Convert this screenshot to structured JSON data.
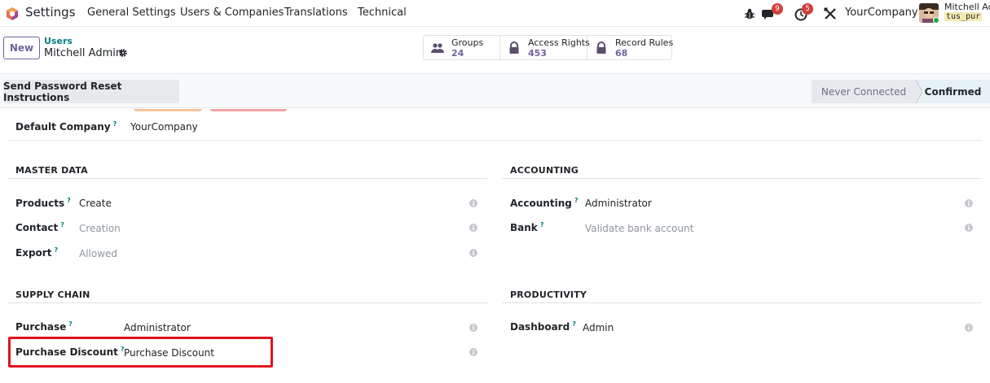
{
  "navbar": {
    "app_name": "Settings",
    "menu": [
      "General Settings",
      "Users & Companies",
      "Translations",
      "Technical"
    ],
    "messages_badge": "9",
    "activity_badge": "5",
    "company": "YourCompany",
    "user_name": "Mitchell Admin",
    "db_name": "tus_pur"
  },
  "control_panel": {
    "new_label": "New",
    "breadcrumb_parent": "Users",
    "breadcrumb_current": "Mitchell Admin",
    "smart_buttons": [
      {
        "label": "Groups",
        "value": "24",
        "icon": "users-icon"
      },
      {
        "label": "Access Rights",
        "value": "453",
        "icon": "lock-icon"
      },
      {
        "label": "Record Rules",
        "value": "68",
        "icon": "lock-icon"
      }
    ]
  },
  "statusbar": {
    "reset_label": "Send Password Reset Instructions",
    "stages": [
      "Never Connected",
      "Confirmed"
    ],
    "active_stage": "Confirmed"
  },
  "form": {
    "default_company_label": "Default Company",
    "default_company_value": "YourCompany",
    "help_mark": "?",
    "sections": {
      "master_data": {
        "title": "MASTER DATA",
        "fields": [
          {
            "label": "Products",
            "value": "Create"
          },
          {
            "label": "Contact",
            "value": "Creation"
          },
          {
            "label": "Export",
            "value": "Allowed"
          }
        ]
      },
      "accounting": {
        "title": "ACCOUNTING",
        "fields": [
          {
            "label": "Accounting",
            "value": "Administrator"
          },
          {
            "label": "Bank",
            "value": "Validate bank account"
          }
        ]
      },
      "supply_chain": {
        "title": "SUPPLY CHAIN",
        "fields": [
          {
            "label": "Purchase",
            "value": "Administrator"
          },
          {
            "label": "Purchase Discount",
            "value": "Purchase Discount"
          }
        ]
      },
      "productivity": {
        "title": "PRODUCTIVITY",
        "fields": [
          {
            "label": "Dashboard",
            "value": "Admin"
          }
        ]
      }
    }
  },
  "colors": {
    "accent": "#71639e",
    "link": "#017e84",
    "highlight": "#e0131c",
    "badge": "#d23f3a"
  }
}
